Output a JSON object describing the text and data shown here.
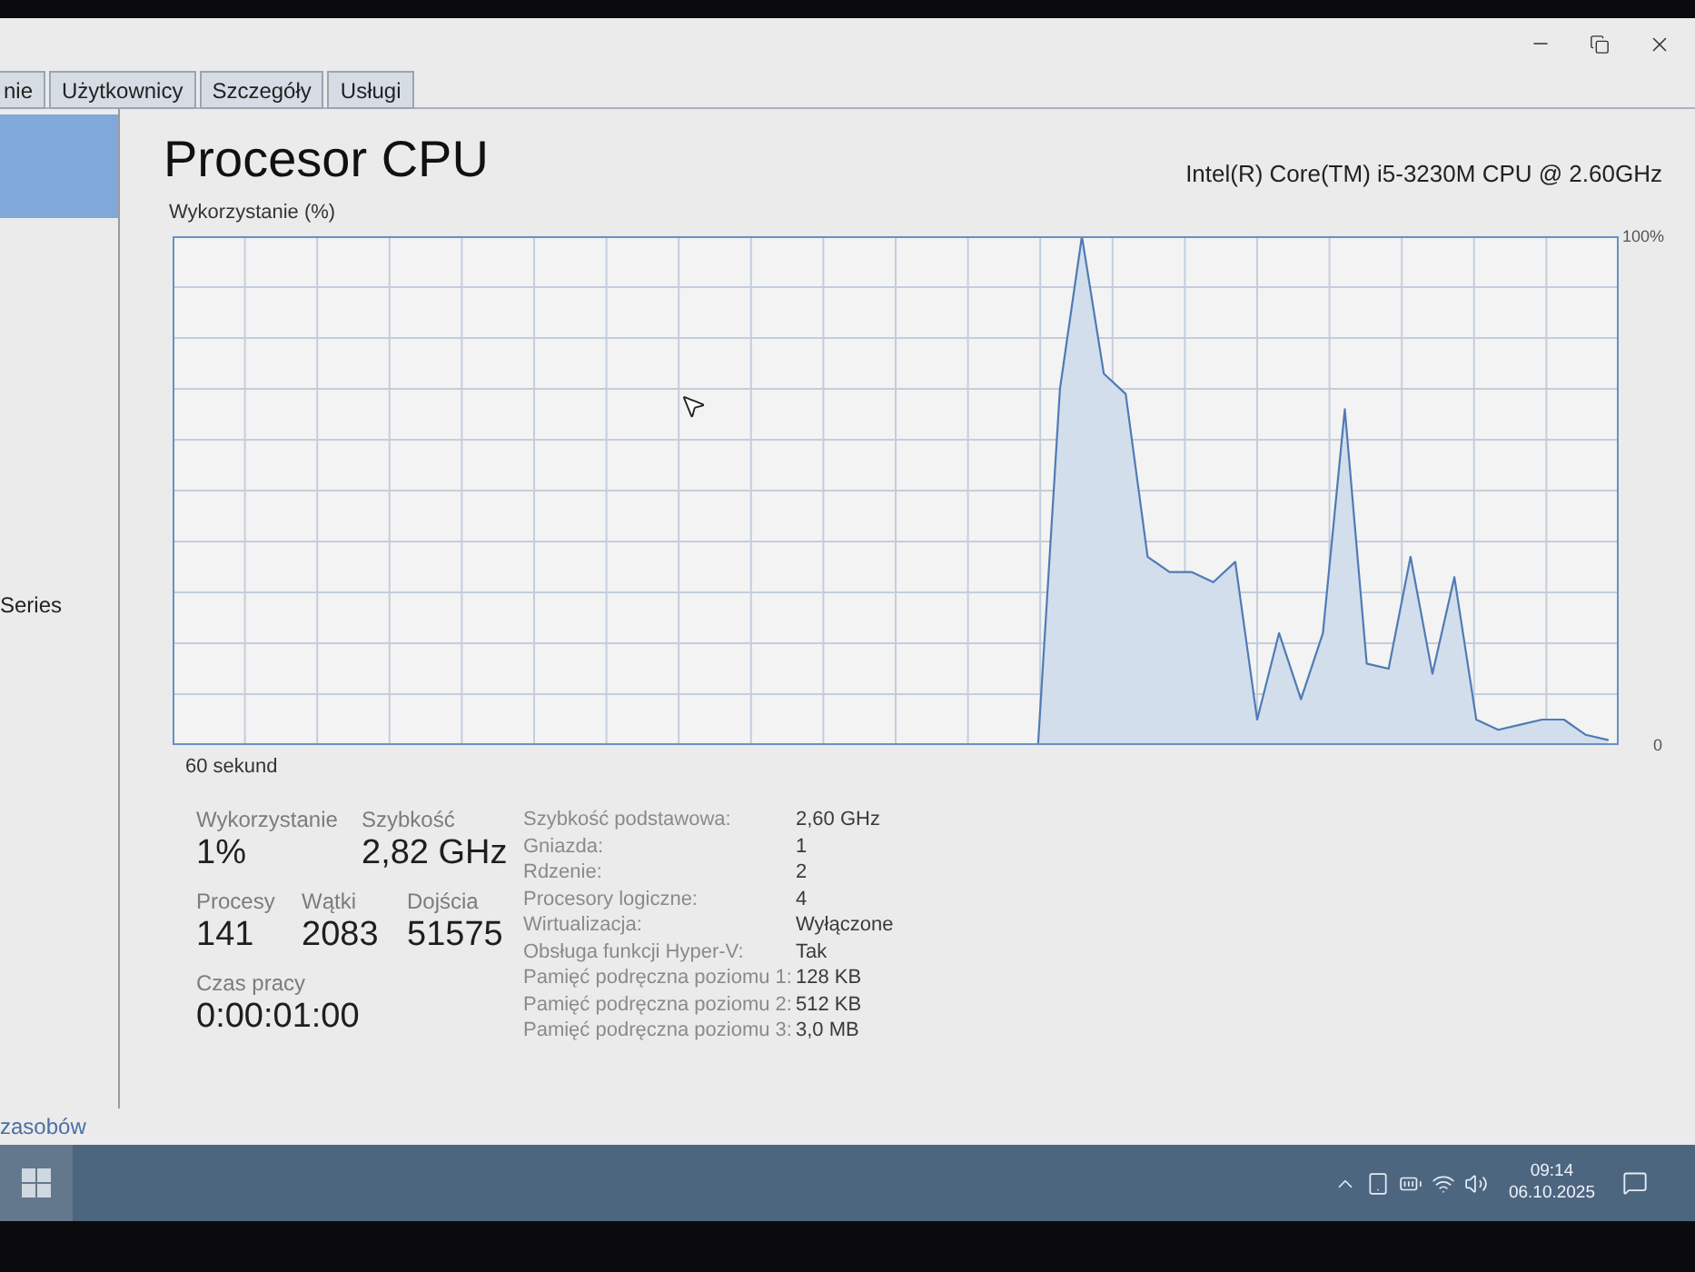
{
  "tabs": [
    {
      "label": "nie",
      "selected": false
    },
    {
      "label": "Użytkownicy",
      "selected": false
    },
    {
      "label": "Szczegóły",
      "selected": false
    },
    {
      "label": "Usługi",
      "selected": false
    }
  ],
  "sidebar": {
    "items": [
      {
        "selected": true
      },
      {
        "label": "Series",
        "selected": false
      }
    ]
  },
  "cpu_panel": {
    "title": "Procesor CPU",
    "model": "Intel(R) Core(TM) i5-3230M CPU @ 2.60GHz",
    "chart_data": {
      "type": "area",
      "xlabel": "60 sekund",
      "ylabel": "Wykorzystanie (%)",
      "ylim": [
        0,
        100
      ],
      "yticks": [
        {
          "value": 0,
          "label": "0"
        },
        {
          "value": 100,
          "label": "100%"
        }
      ],
      "grid": true,
      "values": [
        null,
        null,
        null,
        null,
        null,
        null,
        null,
        null,
        null,
        null,
        null,
        null,
        null,
        null,
        null,
        null,
        null,
        null,
        null,
        null,
        null,
        null,
        null,
        null,
        null,
        null,
        null,
        null,
        null,
        null,
        null,
        null,
        null,
        null,
        null,
        null,
        null,
        null,
        null,
        0,
        70,
        100,
        73,
        69,
        37,
        34,
        34,
        32,
        36,
        5,
        22,
        9,
        22,
        66,
        16,
        15,
        37,
        14,
        33,
        5,
        3,
        4,
        5,
        5,
        2,
        1
      ]
    },
    "stat_rows": [
      {
        "items": [
          {
            "label": "Wykorzystanie",
            "value": "1%"
          },
          {
            "label": "Szybkość",
            "value": "2,82 GHz"
          }
        ]
      },
      {
        "items": [
          {
            "label": "Procesy",
            "value": "141"
          },
          {
            "label": "Wątki",
            "value": "2083"
          },
          {
            "label": "Dojścia",
            "value": "51575"
          }
        ]
      },
      {
        "items": [
          {
            "label": "Czas pracy",
            "value": "0:00:01:00"
          }
        ]
      }
    ],
    "details": [
      {
        "label": "Szybkość podstawowa:",
        "value": "2,60 GHz"
      },
      {
        "label": "Gniazda:",
        "value": "1"
      },
      {
        "label": "Rdzenie:",
        "value": "2"
      },
      {
        "label": "Procesory logiczne:",
        "value": "4"
      },
      {
        "label": "Wirtualizacja:",
        "value": "Wyłączone"
      },
      {
        "label": "Obsługa funkcji Hyper-V:",
        "value": "Tak"
      },
      {
        "label": "Pamięć podręczna poziomu 1:",
        "value": "128 KB"
      },
      {
        "label": "Pamięć podręczna poziomu 2:",
        "value": "512 KB"
      },
      {
        "label": "Pamięć podręczna poziomu 3:",
        "value": "3,0 MB"
      }
    ]
  },
  "footer": {
    "link": "zasobów"
  },
  "taskbar": {
    "clock": {
      "time": "09:14",
      "date": "06.10.2025"
    }
  }
}
